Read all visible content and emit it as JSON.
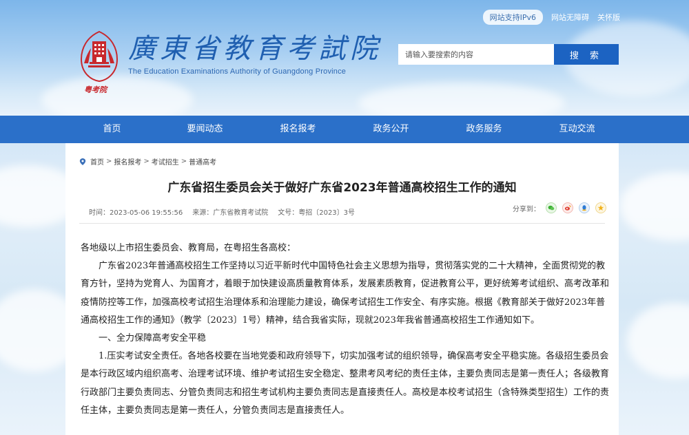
{
  "header": {
    "logo_cn": "廣東省教育考試院",
    "logo_en": "The Education Examinations Authority of Guangdong Province",
    "seal_text": "粤考院",
    "top_links": {
      "ipv6": "网站支持IPv6",
      "accessibility": "网站无障碍",
      "elderly": "关怀版"
    },
    "search": {
      "placeholder": "请输入要搜索的内容",
      "button": "搜 索"
    }
  },
  "nav": {
    "items": [
      "首页",
      "要闻动态",
      "报名报考",
      "政务公开",
      "政务服务",
      "互动交流"
    ]
  },
  "breadcrumb": [
    "首页",
    "报名报考",
    "考试招生",
    "普通高考"
  ],
  "article": {
    "title": "广东省招生委员会关于做好广东省2023年普通高校招生工作的通知",
    "meta": {
      "time": "时间：2023-05-06 19:55:56",
      "source": "来源：广东省教育考试院",
      "doc_no": "文号：粤招〔2023〕3号"
    },
    "share_label": "分享到：",
    "paragraphs": [
      "各地级以上市招生委员会、教育局，在粤招生各高校：",
      "广东省2023年普通高校招生工作坚持以习近平新时代中国特色社会主义思想为指导，贯彻落实党的二十大精神，全面贯彻党的教育方针，坚持为党育人、为国育才，着眼于加快建设高质量教育体系，发展素质教育，促进教育公平，更好统筹考试组织、高考改革和疫情防控等工作，加强高校考试招生治理体系和治理能力建设，确保考试招生工作安全、有序实施。根据《教育部关于做好2023年普通高校招生工作的通知》（教学〔2023〕1号）精神，结合我省实际，现就2023年我省普通高校招生工作通知如下。",
      "一、全力保障高考安全平稳",
      "1.压实考试安全责任。各地各校要在当地党委和政府领导下，切实加强考试的组织领导，确保高考安全平稳实施。各级招生委员会是本行政区域内组织高考、治理考试环境、维护考试招生安全稳定、整肃考风考纪的责任主体，主要负责同志是第一责任人；各级教育行政部门主要负责同志、分管负责同志和招生考试机构主要负责同志是直接责任人。高校是本校考试招生（含特殊类型招生）工作的责任主体，主要负责同志是第一责任人，分管负责同志是直接责任人。"
    ]
  },
  "colors": {
    "nav_bg": "#2b70c9",
    "search_button": "#1c63c2",
    "logo_text": "#1f5fb0",
    "seal_red": "#c8282d"
  }
}
